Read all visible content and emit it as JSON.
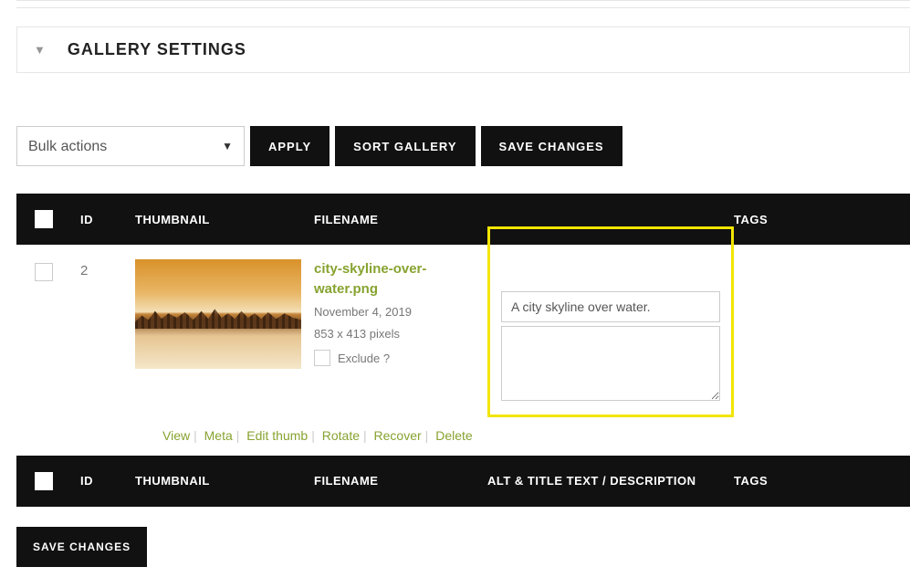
{
  "settings": {
    "title": "GALLERY SETTINGS"
  },
  "toolbar": {
    "bulk_placeholder": "Bulk actions",
    "apply": "APPLY",
    "sort": "SORT GALLERY",
    "save": "SAVE CHANGES"
  },
  "columns": {
    "id": "ID",
    "thumbnail": "THUMBNAIL",
    "filename": "FILENAME",
    "alt": "ALT & TITLE TEXT / DESCRIPTION",
    "tags": "TAGS"
  },
  "row": {
    "id": "2",
    "filename": "city-skyline-over-water.png",
    "date": "November 4, 2019",
    "dimensions": "853 x 413 pixels",
    "exclude_label": "Exclude ?",
    "alt_value": "A city skyline over water.",
    "actions": {
      "view": "View",
      "meta": "Meta",
      "edit_thumb": "Edit thumb",
      "rotate": "Rotate",
      "recover": "Recover",
      "delete": "Delete"
    }
  },
  "bottom": {
    "save": "SAVE CHANGES"
  }
}
